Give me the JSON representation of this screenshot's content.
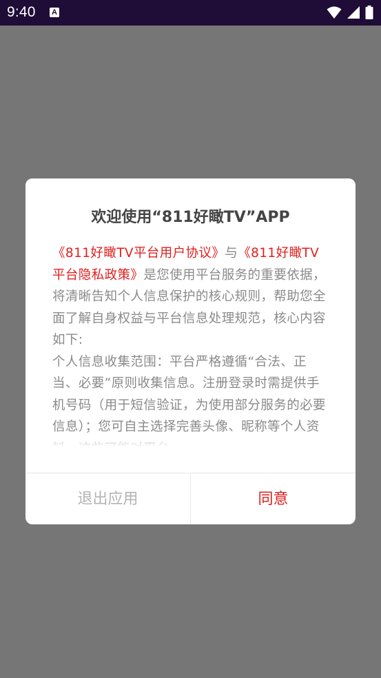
{
  "status_bar": {
    "time": "9:40",
    "notification_icon": "accessibility-a-icon",
    "icons": [
      "wifi-icon",
      "signal-icon",
      "battery-icon"
    ]
  },
  "dialog": {
    "title": "欢迎使用“811好瞰TV”APP",
    "body": {
      "link_user_agreement": "《811好瞰TV平台用户协议》",
      "connector": "与",
      "link_privacy_policy": "《811好瞰TV平台隐私政策》",
      "intro_text": "是您使用平台服务的重要依据，将清晰告知个人信息保护的核心规则，帮助您全面了解自身权益与平台信息处理规范，核心内容如下:",
      "collection_text": "个人信息收集范围：平台严格遵循“合法、正当、必要”原则收集信息。注册登录时需提供手机号码（用于短信验证，为使用部分服务的必要信息）；您可自主选择完善头像、昵称等个人资料，这些可能对平台"
    },
    "buttons": {
      "exit_label": "退出应用",
      "agree_label": "同意"
    }
  },
  "colors": {
    "status_bar_bg": "#1f0c37",
    "overlay_bg": "#767676",
    "link": "#e0201e",
    "agree": "#d9201d",
    "body_text": "#8a8a8a",
    "exit_text": "#b3b3b3"
  }
}
